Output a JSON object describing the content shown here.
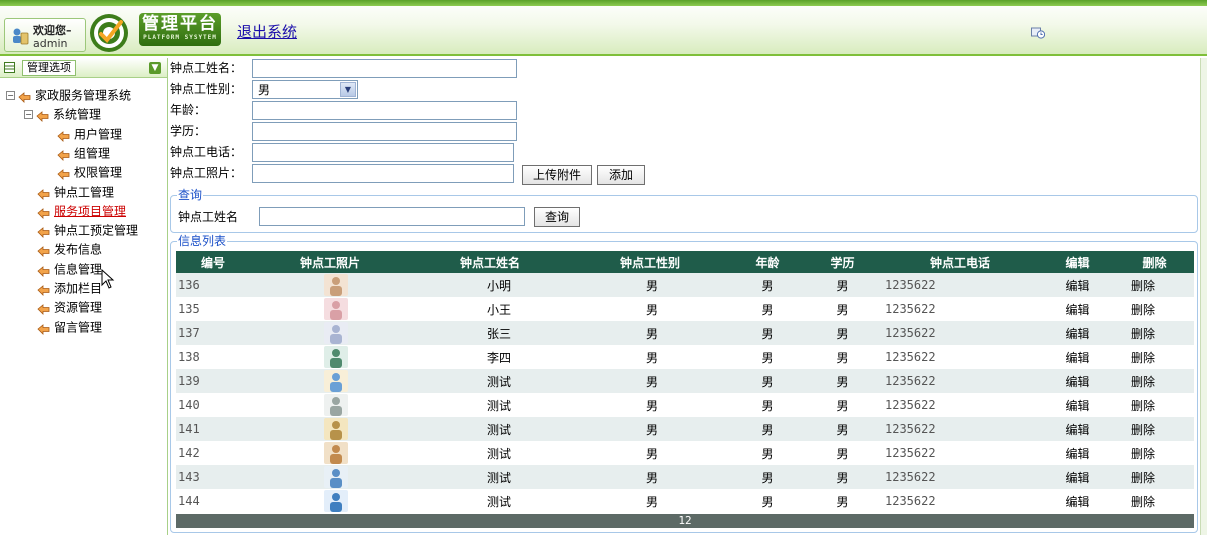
{
  "header": {
    "welcome": "欢迎您–",
    "user": "admin",
    "logo_title": "管理平台",
    "logo_subtitle": "PLATFORM SYSYTEM",
    "logout": "退出系统"
  },
  "sidebar": {
    "title": "管理选项",
    "tree": [
      {
        "label": "家政服务管理系统",
        "level": 0,
        "toggle": "−"
      },
      {
        "label": "系统管理",
        "level": 1,
        "toggle": "−"
      },
      {
        "label": "用户管理",
        "level": 2
      },
      {
        "label": "组管理",
        "level": 2
      },
      {
        "label": "权限管理",
        "level": 2
      },
      {
        "label": "钟点工管理",
        "level": 1
      },
      {
        "label": "服务项目管理",
        "level": 1,
        "active": true
      },
      {
        "label": "钟点工预定管理",
        "level": 1
      },
      {
        "label": "发布信息",
        "level": 1
      },
      {
        "label": "信息管理",
        "level": 1
      },
      {
        "label": "添加栏目",
        "level": 1
      },
      {
        "label": "资源管理",
        "level": 1
      },
      {
        "label": "留言管理",
        "level": 1
      }
    ]
  },
  "form": {
    "name_label": "钟点工姓名：",
    "gender_label": "钟点工性别：",
    "gender_value": "男",
    "age_label": "年龄：",
    "education_label": "学历：",
    "phone_label": "钟点工电话：",
    "photo_label": "钟点工照片：",
    "upload_button": "上传附件",
    "add_button": "添加"
  },
  "query": {
    "legend": "查询",
    "name_label": "钟点工姓名",
    "search_button": "查询"
  },
  "list": {
    "legend": "信息列表",
    "columns": [
      "编号",
      "钟点工照片",
      "钟点工姓名",
      "钟点工性别",
      "年龄",
      "学历",
      "钟点工电话",
      "编辑",
      "删除"
    ],
    "rows": [
      {
        "id": "136",
        "name": "小明",
        "gender": "男",
        "age": "男",
        "education": "男",
        "phone": "1235622",
        "edit": "编辑",
        "delete": "删除"
      },
      {
        "id": "135",
        "name": "小王",
        "gender": "男",
        "age": "男",
        "education": "男",
        "phone": "1235622",
        "edit": "编辑",
        "delete": "删除"
      },
      {
        "id": "137",
        "name": "张三",
        "gender": "男",
        "age": "男",
        "education": "男",
        "phone": "1235622",
        "edit": "编辑",
        "delete": "删除"
      },
      {
        "id": "138",
        "name": "李四",
        "gender": "男",
        "age": "男",
        "education": "男",
        "phone": "1235622",
        "edit": "编辑",
        "delete": "删除"
      },
      {
        "id": "139",
        "name": "测试",
        "gender": "男",
        "age": "男",
        "education": "男",
        "phone": "1235622",
        "edit": "编辑",
        "delete": "删除"
      },
      {
        "id": "140",
        "name": "测试",
        "gender": "男",
        "age": "男",
        "education": "男",
        "phone": "1235622",
        "edit": "编辑",
        "delete": "删除"
      },
      {
        "id": "141",
        "name": "测试",
        "gender": "男",
        "age": "男",
        "education": "男",
        "phone": "1235622",
        "edit": "编辑",
        "delete": "删除"
      },
      {
        "id": "142",
        "name": "测试",
        "gender": "男",
        "age": "男",
        "education": "男",
        "phone": "1235622",
        "edit": "编辑",
        "delete": "删除"
      },
      {
        "id": "143",
        "name": "测试",
        "gender": "男",
        "age": "男",
        "education": "男",
        "phone": "1235622",
        "edit": "编辑",
        "delete": "删除"
      },
      {
        "id": "144",
        "name": "测试",
        "gender": "男",
        "age": "男",
        "education": "男",
        "phone": "1235622",
        "edit": "编辑",
        "delete": "删除"
      }
    ],
    "pager": "12"
  },
  "colors": {
    "brand_green": "#5c9e2a",
    "table_header": "#1f5c4a",
    "row_alt": "#e7eeee",
    "legend_blue": "#1a50c8",
    "link_blue": "#1a0dab",
    "active_red": "#cc0000"
  },
  "icons": {
    "user": "user-icon",
    "logo": "logo-target-icon",
    "clock": "clock-icon",
    "menu": "menu-grid-icon",
    "collapse": "collapse-arrow-icon",
    "folder": "folder-icon",
    "cursor": "mouse-cursor-icon",
    "dropdown": "chevron-down-icon"
  }
}
